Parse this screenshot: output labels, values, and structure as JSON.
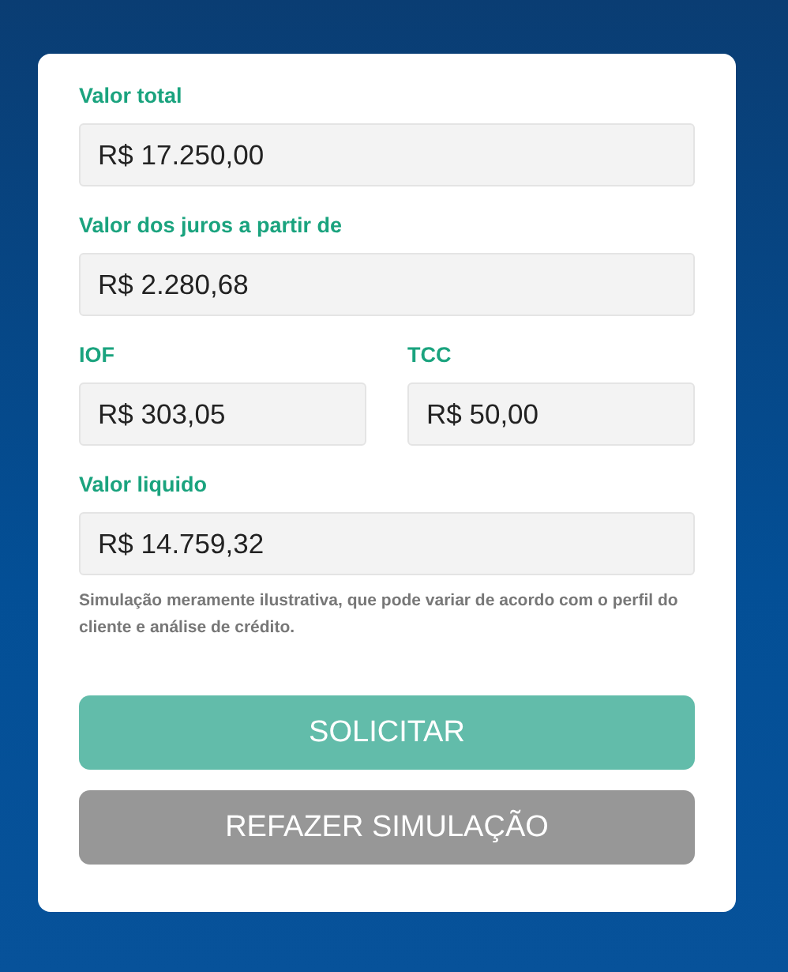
{
  "rows": [
    {
      "fields": [
        {
          "label": "Valor total",
          "value": "R$ 17.250,00"
        }
      ]
    },
    {
      "fields": [
        {
          "label": "Valor dos juros a partir de",
          "value": "R$ 2.280,68"
        }
      ]
    },
    {
      "fields": [
        {
          "label": "IOF",
          "value": "R$ 303,05"
        },
        {
          "label": "TCC",
          "value": "R$ 50,00"
        }
      ]
    },
    {
      "fields": [
        {
          "label": "Valor liquido",
          "value": "R$ 14.759,32"
        }
      ]
    }
  ],
  "note": "Simulação meramente ilustrativa, que pode variar de acordo com o perfil do cliente e análise de crédito.",
  "buttons": [
    {
      "label": "SOLICITAR",
      "kind": "primary"
    },
    {
      "label": "REFAZER SIMULAÇÃO",
      "kind": "secondary"
    }
  ]
}
